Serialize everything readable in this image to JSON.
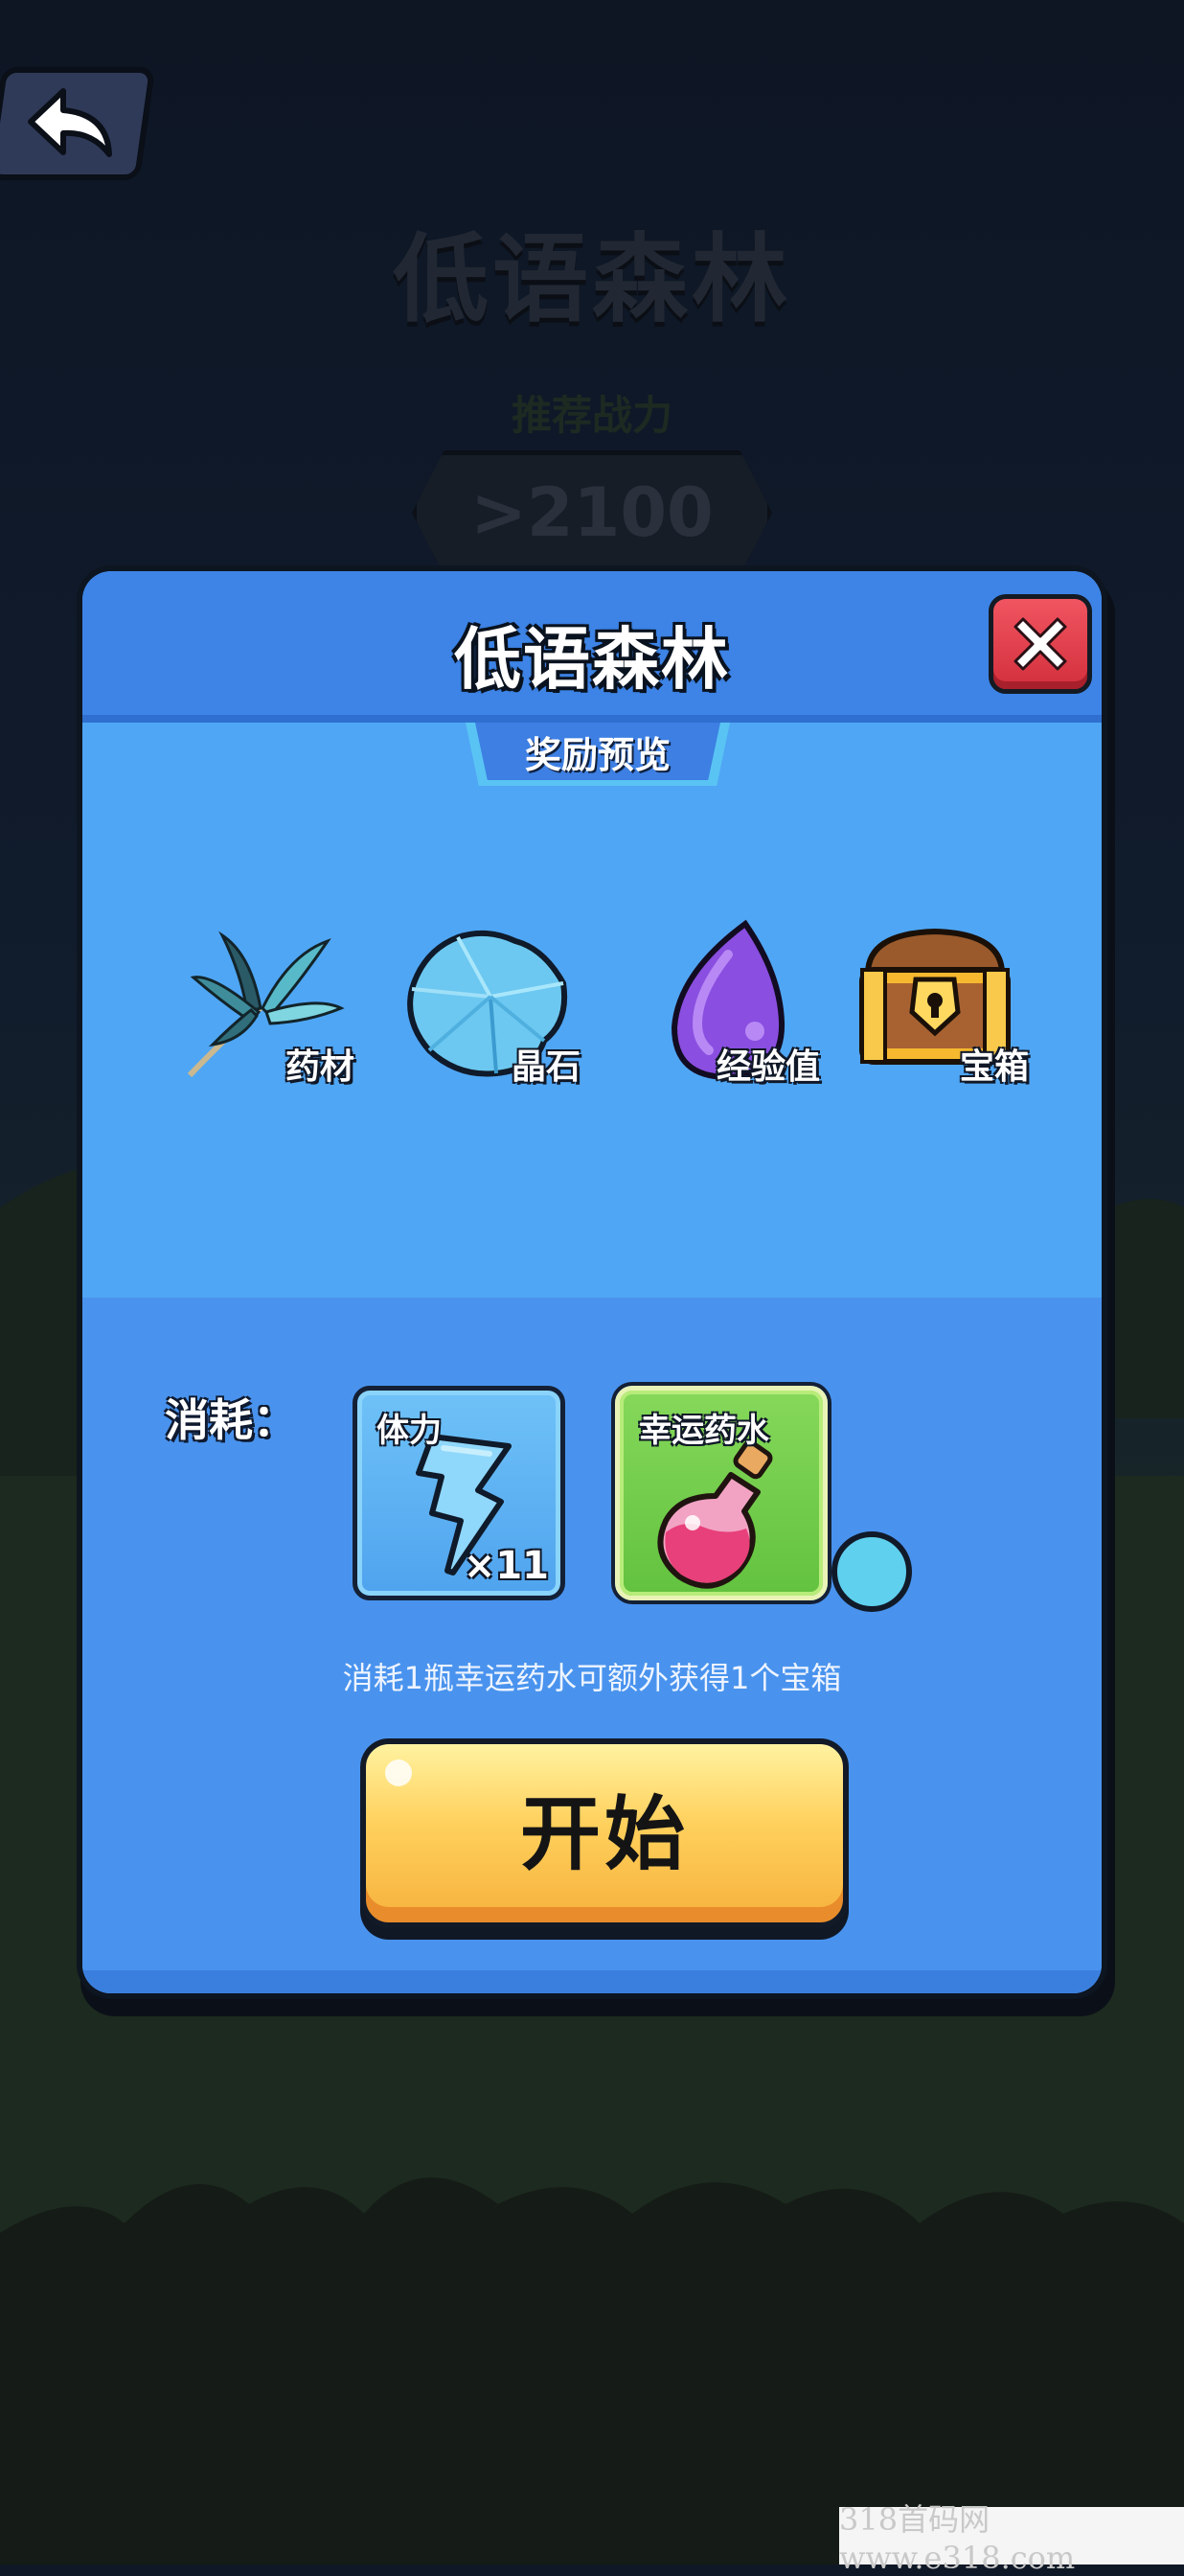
{
  "background": {
    "title": "低语森林",
    "recommended_power_label": "推荐战力",
    "recommended_power_value": ">2100"
  },
  "dialog": {
    "title": "低语森林",
    "rewards_tab": "奖励预览",
    "rewards": [
      {
        "label": "药材",
        "icon": "herb-icon"
      },
      {
        "label": "晶石",
        "icon": "crystal-icon"
      },
      {
        "label": "经验值",
        "icon": "exp-drop-icon"
      },
      {
        "label": "宝箱",
        "icon": "treasure-chest-icon"
      }
    ],
    "cost_label": "消耗：",
    "costs": [
      {
        "title": "体力",
        "count": "×11",
        "icon": "lightning-icon"
      },
      {
        "title": "幸运药水",
        "icon": "potion-icon"
      }
    ],
    "hint": "消耗1瓶幸运药水可额外获得1个宝箱",
    "start_button": "开始"
  },
  "watermark": "318首码网 www.e318.com",
  "colors": {
    "dialog_header": "#3d84e6",
    "rewards_bg": "#4fa6f4",
    "cost_bg": "#4993ee",
    "close_red": "#e23f4b",
    "start_yellow": "#ffd05c",
    "potion_card_green": "#6fc847"
  }
}
